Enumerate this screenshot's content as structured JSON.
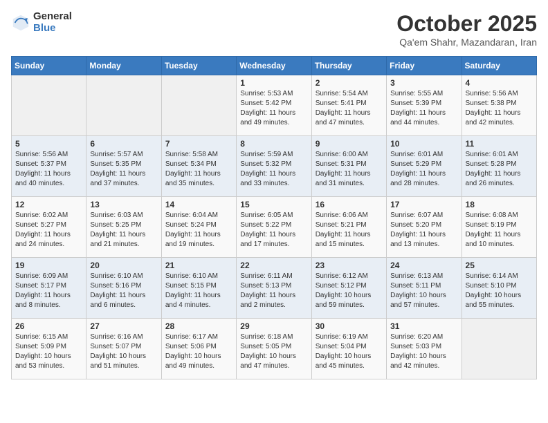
{
  "logo": {
    "general": "General",
    "blue": "Blue"
  },
  "header": {
    "month": "October 2025",
    "location": "Qa'em Shahr, Mazandaran, Iran"
  },
  "weekdays": [
    "Sunday",
    "Monday",
    "Tuesday",
    "Wednesday",
    "Thursday",
    "Friday",
    "Saturday"
  ],
  "weeks": [
    [
      {
        "day": "",
        "info": ""
      },
      {
        "day": "",
        "info": ""
      },
      {
        "day": "",
        "info": ""
      },
      {
        "day": "1",
        "info": "Sunrise: 5:53 AM\nSunset: 5:42 PM\nDaylight: 11 hours\nand 49 minutes."
      },
      {
        "day": "2",
        "info": "Sunrise: 5:54 AM\nSunset: 5:41 PM\nDaylight: 11 hours\nand 47 minutes."
      },
      {
        "day": "3",
        "info": "Sunrise: 5:55 AM\nSunset: 5:39 PM\nDaylight: 11 hours\nand 44 minutes."
      },
      {
        "day": "4",
        "info": "Sunrise: 5:56 AM\nSunset: 5:38 PM\nDaylight: 11 hours\nand 42 minutes."
      }
    ],
    [
      {
        "day": "5",
        "info": "Sunrise: 5:56 AM\nSunset: 5:37 PM\nDaylight: 11 hours\nand 40 minutes."
      },
      {
        "day": "6",
        "info": "Sunrise: 5:57 AM\nSunset: 5:35 PM\nDaylight: 11 hours\nand 37 minutes."
      },
      {
        "day": "7",
        "info": "Sunrise: 5:58 AM\nSunset: 5:34 PM\nDaylight: 11 hours\nand 35 minutes."
      },
      {
        "day": "8",
        "info": "Sunrise: 5:59 AM\nSunset: 5:32 PM\nDaylight: 11 hours\nand 33 minutes."
      },
      {
        "day": "9",
        "info": "Sunrise: 6:00 AM\nSunset: 5:31 PM\nDaylight: 11 hours\nand 31 minutes."
      },
      {
        "day": "10",
        "info": "Sunrise: 6:01 AM\nSunset: 5:29 PM\nDaylight: 11 hours\nand 28 minutes."
      },
      {
        "day": "11",
        "info": "Sunrise: 6:01 AM\nSunset: 5:28 PM\nDaylight: 11 hours\nand 26 minutes."
      }
    ],
    [
      {
        "day": "12",
        "info": "Sunrise: 6:02 AM\nSunset: 5:27 PM\nDaylight: 11 hours\nand 24 minutes."
      },
      {
        "day": "13",
        "info": "Sunrise: 6:03 AM\nSunset: 5:25 PM\nDaylight: 11 hours\nand 21 minutes."
      },
      {
        "day": "14",
        "info": "Sunrise: 6:04 AM\nSunset: 5:24 PM\nDaylight: 11 hours\nand 19 minutes."
      },
      {
        "day": "15",
        "info": "Sunrise: 6:05 AM\nSunset: 5:22 PM\nDaylight: 11 hours\nand 17 minutes."
      },
      {
        "day": "16",
        "info": "Sunrise: 6:06 AM\nSunset: 5:21 PM\nDaylight: 11 hours\nand 15 minutes."
      },
      {
        "day": "17",
        "info": "Sunrise: 6:07 AM\nSunset: 5:20 PM\nDaylight: 11 hours\nand 13 minutes."
      },
      {
        "day": "18",
        "info": "Sunrise: 6:08 AM\nSunset: 5:19 PM\nDaylight: 11 hours\nand 10 minutes."
      }
    ],
    [
      {
        "day": "19",
        "info": "Sunrise: 6:09 AM\nSunset: 5:17 PM\nDaylight: 11 hours\nand 8 minutes."
      },
      {
        "day": "20",
        "info": "Sunrise: 6:10 AM\nSunset: 5:16 PM\nDaylight: 11 hours\nand 6 minutes."
      },
      {
        "day": "21",
        "info": "Sunrise: 6:10 AM\nSunset: 5:15 PM\nDaylight: 11 hours\nand 4 minutes."
      },
      {
        "day": "22",
        "info": "Sunrise: 6:11 AM\nSunset: 5:13 PM\nDaylight: 11 hours\nand 2 minutes."
      },
      {
        "day": "23",
        "info": "Sunrise: 6:12 AM\nSunset: 5:12 PM\nDaylight: 10 hours\nand 59 minutes."
      },
      {
        "day": "24",
        "info": "Sunrise: 6:13 AM\nSunset: 5:11 PM\nDaylight: 10 hours\nand 57 minutes."
      },
      {
        "day": "25",
        "info": "Sunrise: 6:14 AM\nSunset: 5:10 PM\nDaylight: 10 hours\nand 55 minutes."
      }
    ],
    [
      {
        "day": "26",
        "info": "Sunrise: 6:15 AM\nSunset: 5:09 PM\nDaylight: 10 hours\nand 53 minutes."
      },
      {
        "day": "27",
        "info": "Sunrise: 6:16 AM\nSunset: 5:07 PM\nDaylight: 10 hours\nand 51 minutes."
      },
      {
        "day": "28",
        "info": "Sunrise: 6:17 AM\nSunset: 5:06 PM\nDaylight: 10 hours\nand 49 minutes."
      },
      {
        "day": "29",
        "info": "Sunrise: 6:18 AM\nSunset: 5:05 PM\nDaylight: 10 hours\nand 47 minutes."
      },
      {
        "day": "30",
        "info": "Sunrise: 6:19 AM\nSunset: 5:04 PM\nDaylight: 10 hours\nand 45 minutes."
      },
      {
        "day": "31",
        "info": "Sunrise: 6:20 AM\nSunset: 5:03 PM\nDaylight: 10 hours\nand 42 minutes."
      },
      {
        "day": "",
        "info": ""
      }
    ]
  ]
}
